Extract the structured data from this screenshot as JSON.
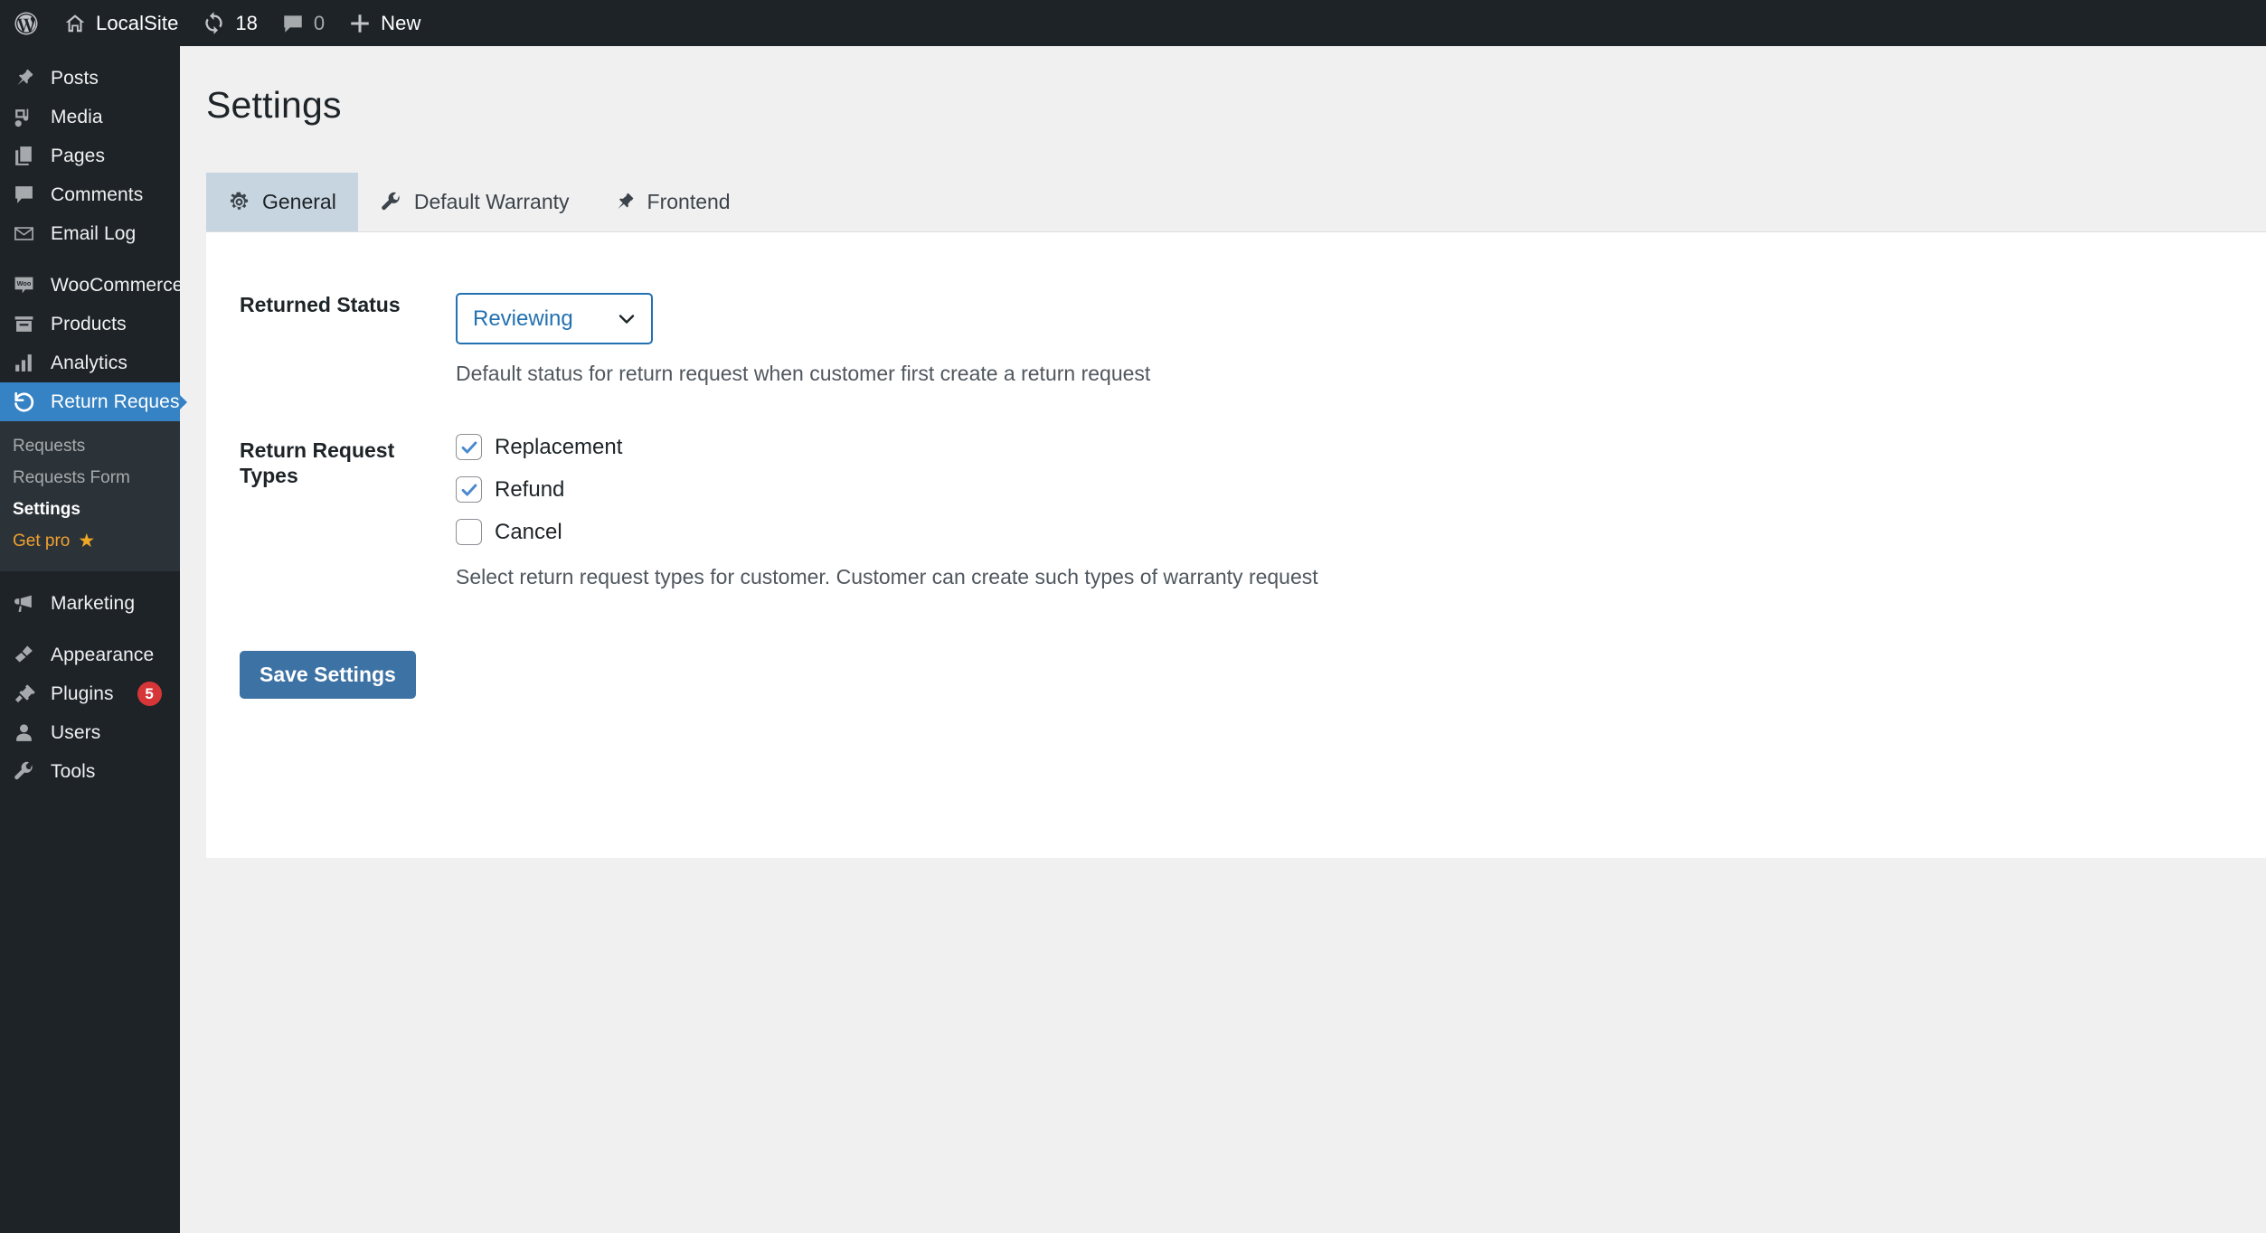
{
  "adminbar": {
    "logo_icon": "wordpress-logo-icon",
    "site_icon": "home-icon",
    "site_name": "LocalSite",
    "updates_icon": "updates-icon",
    "updates_count": "18",
    "comments_icon": "comment-icon",
    "comments_count": "0",
    "new_icon": "plus-icon",
    "new_label": "New"
  },
  "sidebar": {
    "items": [
      {
        "label": "Posts",
        "icon": "pin-icon",
        "current": false,
        "badge": ""
      },
      {
        "label": "Media",
        "icon": "media-icon",
        "current": false,
        "badge": ""
      },
      {
        "label": "Pages",
        "icon": "pages-icon",
        "current": false,
        "badge": ""
      },
      {
        "label": "Comments",
        "icon": "comment-icon",
        "current": false,
        "badge": ""
      },
      {
        "label": "Email Log",
        "icon": "envelope-icon",
        "current": false,
        "badge": ""
      },
      {
        "label": "WooCommerce",
        "icon": "woo-icon",
        "current": false,
        "badge": ""
      },
      {
        "label": "Products",
        "icon": "products-icon",
        "current": false,
        "badge": ""
      },
      {
        "label": "Analytics",
        "icon": "analytics-icon",
        "current": false,
        "badge": ""
      },
      {
        "label": "Return Request",
        "icon": "undo-arrow-icon",
        "current": true,
        "badge": ""
      },
      {
        "label": "Marketing",
        "icon": "megaphone-icon",
        "current": false,
        "badge": ""
      },
      {
        "label": "Appearance",
        "icon": "brush-icon",
        "current": false,
        "badge": ""
      },
      {
        "label": "Plugins",
        "icon": "plug-icon",
        "current": false,
        "badge": "5"
      },
      {
        "label": "Users",
        "icon": "user-icon",
        "current": false,
        "badge": ""
      },
      {
        "label": "Tools",
        "icon": "wrench-icon",
        "current": false,
        "badge": ""
      }
    ],
    "submenu": {
      "requests": "Requests",
      "requests_form": "Requests Form",
      "settings": "Settings",
      "get_pro": "Get pro",
      "star_icon": "star-icon"
    }
  },
  "page": {
    "title": "Settings"
  },
  "tabs": [
    {
      "label": "General",
      "icon": "gear-icon",
      "active": true
    },
    {
      "label": "Default Warranty",
      "icon": "wrench-icon",
      "active": false
    },
    {
      "label": "Frontend",
      "icon": "pin-icon",
      "active": false
    }
  ],
  "form": {
    "returned_status": {
      "label": "Returned Status",
      "value": "Reviewing",
      "options": [
        "Reviewing"
      ],
      "chevron_icon": "chevron-down-icon",
      "description": "Default status for return request when customer first create a return request"
    },
    "request_types": {
      "label": "Return Request Types",
      "options": [
        {
          "label": "Replacement",
          "checked": true
        },
        {
          "label": "Refund",
          "checked": true
        },
        {
          "label": "Cancel",
          "checked": false
        }
      ],
      "description": "Select return request types for customer. Customer can create such types of warranty request"
    },
    "save_label": "Save Settings"
  },
  "colors": {
    "admin_dark": "#1d2327",
    "submenu_dark": "#2c3338",
    "accent_blue": "#3582c4",
    "link_blue": "#2271b1",
    "button_blue": "#3d72a4",
    "badge_red": "#d63638",
    "pro_orange": "#f0a030",
    "tab_active": "#c6d5e0",
    "page_bg": "#f0f0f1"
  }
}
